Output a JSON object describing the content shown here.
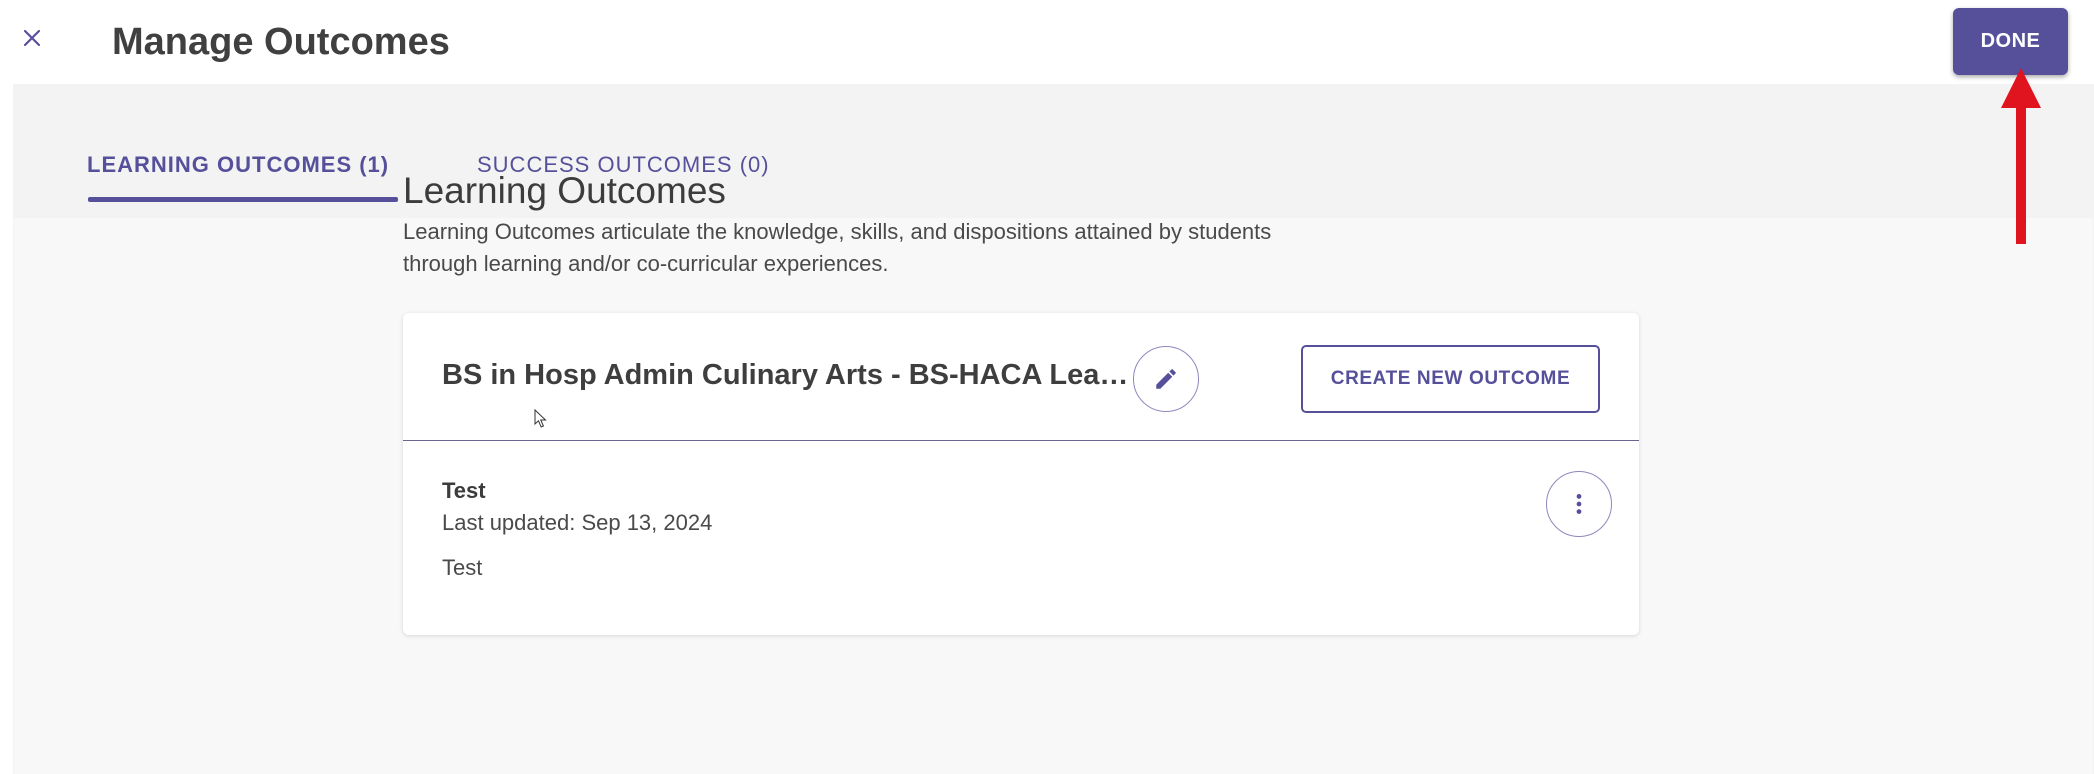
{
  "header": {
    "title": "Manage Outcomes",
    "done_label": "DONE",
    "close_icon": "close-icon"
  },
  "tabs": [
    {
      "label": "LEARNING OUTCOMES (1)",
      "active": true
    },
    {
      "label": "SUCCESS OUTCOMES (0)",
      "active": false
    }
  ],
  "section": {
    "title": "Learning Outcomes",
    "description": "Learning Outcomes articulate the knowledge, skills, and dispositions attained by students through learning and/or co-curricular experiences."
  },
  "card": {
    "title": "BS in Hosp Admin Culinary Arts - BS-HACA Learning Outcomes",
    "edit_icon": "pencil-icon",
    "create_label": "CREATE NEW OUTCOME",
    "items": [
      {
        "name": "Test",
        "last_updated": "Last updated: Sep 13, 2024",
        "description": "Test",
        "menu_icon": "more-vertical-icon"
      }
    ]
  },
  "colors": {
    "accent": "#56509b",
    "annotation": "#e0141e",
    "content_bg": "#f8f8f8",
    "tabbar_bg": "#f3f3f3"
  }
}
